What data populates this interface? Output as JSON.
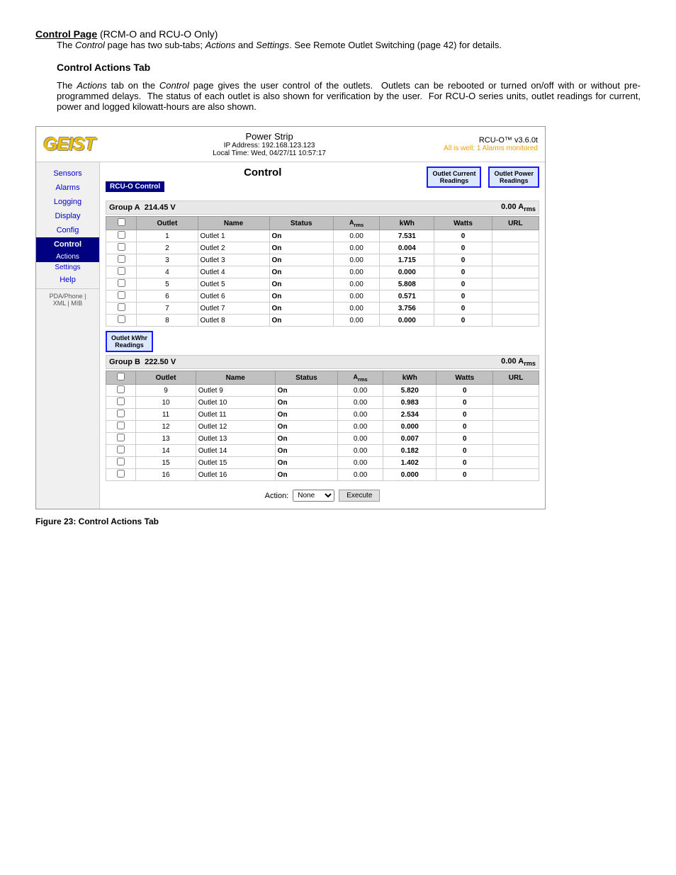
{
  "page": {
    "title": "Control Page",
    "title_suffix": " (RCM-O and RCU-O Only)",
    "intro": "The Control page has two sub-tabs; Actions and Settings. See Remote Outlet Switching (page 42) for details.",
    "section_title": "Control Actions Tab",
    "section_body": "The Actions tab on the Control page gives the user control of the outlets.  Outlets can be rebooted or turned on/off with or without pre-programmed delays.  The status of each outlet is also shown for verification by the user.  For RCU-O series units, outlet readings for current, power and logged kilowatt-hours are also shown.",
    "figure_caption": "Figure 23: Control Actions Tab"
  },
  "device": {
    "logo": "GEIST",
    "type": "Power Strip",
    "ip": "IP Address: 192.168.123.123",
    "local_time": "Local Time: Wed, 04/27/11 10:57:17",
    "firmware": "RCU-O™ v3.6.0t",
    "status": "All is well: 1 Alarms monitored"
  },
  "sidebar": {
    "items": [
      {
        "label": "Sensors",
        "active": false
      },
      {
        "label": "Alarms",
        "active": false
      },
      {
        "label": "Logging",
        "active": false
      },
      {
        "label": "Display",
        "active": false
      },
      {
        "label": "Config",
        "active": false
      },
      {
        "label": "Control",
        "active": true
      },
      {
        "label": "Actions",
        "active": true,
        "sub": true
      },
      {
        "label": "Settings",
        "active": false,
        "sub": true
      },
      {
        "label": "Help",
        "active": false
      }
    ],
    "footer": "PDA/Phone | XML | MIB"
  },
  "control": {
    "title": "Control",
    "rcu_label": "RCU-O Control",
    "callout_current": "Outlet Current\nReadings",
    "callout_power": "Outlet Power\nReadings",
    "callout_kwhr": "Outlet kWhr\nReadings",
    "group_a": {
      "label": "Group A",
      "voltage": "214.45 V",
      "arms": "0.00 Arms",
      "columns": [
        "Outlet",
        "Name",
        "Status",
        "Arms",
        "kWh",
        "Watts",
        "URL"
      ],
      "rows": [
        {
          "outlet": 1,
          "name": "Outlet 1",
          "status": "On",
          "arms": "0.00",
          "kwh": "7.531",
          "watts": "0",
          "url": ""
        },
        {
          "outlet": 2,
          "name": "Outlet 2",
          "status": "On",
          "arms": "0.00",
          "kwh": "0.004",
          "watts": "0",
          "url": ""
        },
        {
          "outlet": 3,
          "name": "Outlet 3",
          "status": "On",
          "arms": "0.00",
          "kwh": "1.715",
          "watts": "0",
          "url": ""
        },
        {
          "outlet": 4,
          "name": "Outlet 4",
          "status": "On",
          "arms": "0.00",
          "kwh": "0.000",
          "watts": "0",
          "url": ""
        },
        {
          "outlet": 5,
          "name": "Outlet 5",
          "status": "On",
          "arms": "0.00",
          "kwh": "5.808",
          "watts": "0",
          "url": ""
        },
        {
          "outlet": 6,
          "name": "Outlet 6",
          "status": "On",
          "arms": "0.00",
          "kwh": "0.571",
          "watts": "0",
          "url": ""
        },
        {
          "outlet": 7,
          "name": "Outlet 7",
          "status": "On",
          "arms": "0.00",
          "kwh": "3.756",
          "watts": "0",
          "url": ""
        },
        {
          "outlet": 8,
          "name": "Outlet 8",
          "status": "On",
          "arms": "0.00",
          "kwh": "0.000",
          "watts": "0",
          "url": ""
        }
      ]
    },
    "group_b": {
      "label": "Group B",
      "voltage": "222.50 V",
      "arms": "0.00 Arms",
      "columns": [
        "Outlet",
        "Name",
        "Status",
        "Arms",
        "kWh",
        "Watts",
        "URL"
      ],
      "rows": [
        {
          "outlet": 9,
          "name": "Outlet 9",
          "status": "On",
          "arms": "0.00",
          "kwh": "5.820",
          "watts": "0",
          "url": ""
        },
        {
          "outlet": 10,
          "name": "Outlet 10",
          "status": "On",
          "arms": "0.00",
          "kwh": "0.983",
          "watts": "0",
          "url": ""
        },
        {
          "outlet": 11,
          "name": "Outlet 11",
          "status": "On",
          "arms": "0.00",
          "kwh": "2.534",
          "watts": "0",
          "url": ""
        },
        {
          "outlet": 12,
          "name": "Outlet 12",
          "status": "On",
          "arms": "0.00",
          "kwh": "0.000",
          "watts": "0",
          "url": ""
        },
        {
          "outlet": 13,
          "name": "Outlet 13",
          "status": "On",
          "arms": "0.00",
          "kwh": "0.007",
          "watts": "0",
          "url": ""
        },
        {
          "outlet": 14,
          "name": "Outlet 14",
          "status": "On",
          "arms": "0.00",
          "kwh": "0.182",
          "watts": "0",
          "url": ""
        },
        {
          "outlet": 15,
          "name": "Outlet 15",
          "status": "On",
          "arms": "0.00",
          "kwh": "1.402",
          "watts": "0",
          "url": ""
        },
        {
          "outlet": 16,
          "name": "Outlet 16",
          "status": "On",
          "arms": "0.00",
          "kwh": "0.000",
          "watts": "0",
          "url": ""
        }
      ]
    },
    "action_label": "Action:",
    "action_default": "None",
    "execute_label": "Execute"
  }
}
